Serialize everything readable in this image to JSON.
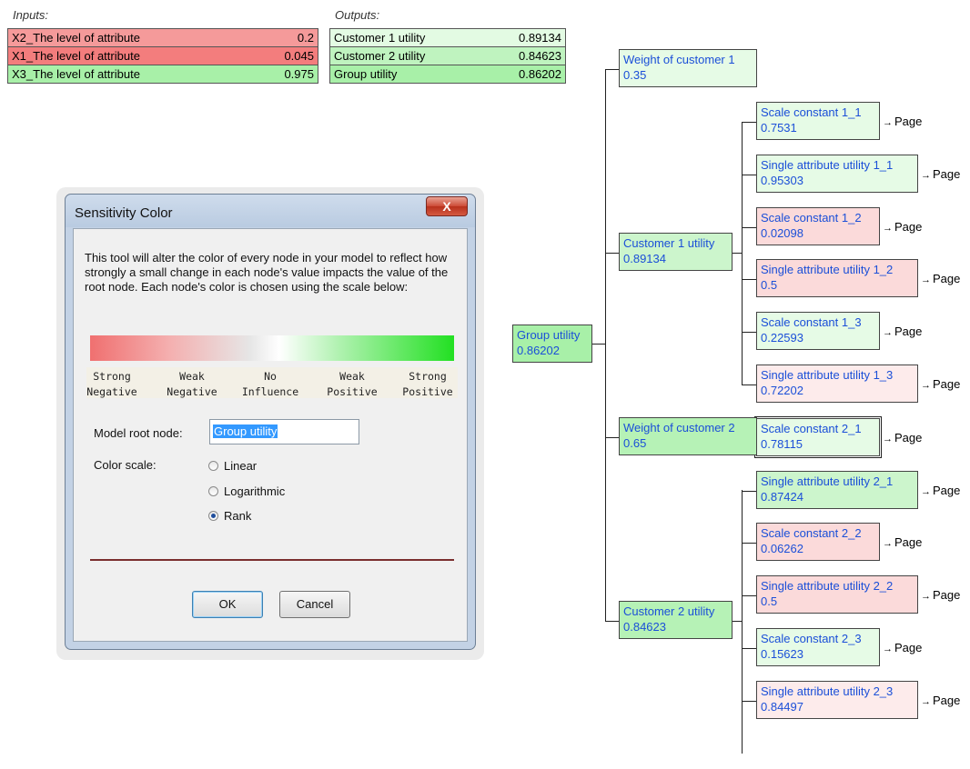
{
  "colors": {
    "green": "#ccf5cc",
    "red": "#f59a9a",
    "light_green": "#e6fbe6",
    "pink": "#fbdada",
    "light_pink": "#fdebeb",
    "node_text": "#1b4fd8"
  },
  "inputs": {
    "header": "Inputs:",
    "rows": [
      {
        "label": "X2_The level of attribute",
        "value": "0.2",
        "color": "#f59a9a"
      },
      {
        "label": "X1_The level of attribute",
        "value": "0.045",
        "color": "#f37d7d"
      },
      {
        "label": "X3_The level of attribute",
        "value": "0.975",
        "color": "#a8f0a8"
      }
    ]
  },
  "outputs": {
    "header": "Outputs:",
    "rows": [
      {
        "label": "Customer 1 utility",
        "value": "0.89134",
        "color": "#e3fbe3"
      },
      {
        "label": "Customer 2 utility",
        "value": "0.84623",
        "color": "#bff3bf"
      },
      {
        "label": "Group utility",
        "value": "0.86202",
        "color": "#a8f0a8"
      }
    ]
  },
  "tree": {
    "page_label": "Page",
    "root": {
      "title": "Group utility",
      "value": "0.86202"
    },
    "weight1": {
      "title": "Weight of customer 1",
      "value": "0.35"
    },
    "cust1": {
      "title": "Customer 1 utility",
      "value": "0.89134"
    },
    "weight2": {
      "title": "Weight of customer 2",
      "value": "0.65"
    },
    "cust2": {
      "title": "Customer 2 utility",
      "value": "0.84623"
    },
    "leaves": [
      {
        "title": "Scale constant 1_1",
        "value": "0.7531"
      },
      {
        "title": "Single attribute utility 1_1",
        "value": "0.95303"
      },
      {
        "title": "Scale constant 1_2",
        "value": "0.02098"
      },
      {
        "title": "Single attribute utility 1_2",
        "value": "0.5"
      },
      {
        "title": "Scale constant 1_3",
        "value": "0.22593"
      },
      {
        "title": "Single attribute utility 1_3",
        "value": "0.72202"
      },
      {
        "title": "Scale constant 2_1",
        "value": "0.78115"
      },
      {
        "title": "Single attribute utility 2_1",
        "value": "0.87424"
      },
      {
        "title": "Scale constant 2_2",
        "value": "0.06262"
      },
      {
        "title": "Single attribute utility 2_2",
        "value": "0.5"
      },
      {
        "title": "Scale constant 2_3",
        "value": "0.15623"
      },
      {
        "title": "Single attribute utility 2_3",
        "value": "0.84497"
      }
    ]
  },
  "dialog": {
    "title": "Sensitivity Color",
    "close_glyph": "X",
    "description": "This tool will alter the color of every node in your model to reflect how strongly a small change in each node's value impacts the value of the root node.  Each node's color is chosen using the scale below:",
    "scale_labels": [
      {
        "line1": "Strong",
        "line2": "Negative"
      },
      {
        "line1": "Weak",
        "line2": "Negative"
      },
      {
        "line1": "No",
        "line2": "Influence"
      },
      {
        "line1": "Weak",
        "line2": "Positive"
      },
      {
        "line1": "Strong",
        "line2": "Positive"
      }
    ],
    "root_label": "Model root node:",
    "root_value": "Group utility",
    "scale_label": "Color scale:",
    "options": {
      "linear": "Linear",
      "log": "Logarithmic",
      "rank": "Rank"
    },
    "selected_option": "Rank",
    "ok": "OK",
    "cancel": "Cancel"
  }
}
